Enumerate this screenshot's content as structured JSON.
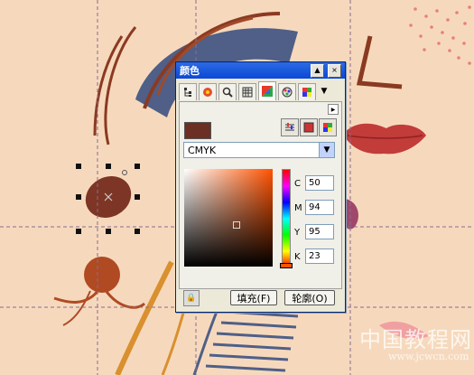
{
  "dialog": {
    "title": "颜色",
    "pin_icon": "▲",
    "close_icon": "×"
  },
  "tabs": [
    {
      "name": "tab-color-eyedropper",
      "icon": "tree-icon"
    },
    {
      "name": "tab-color-harmonies",
      "icon": "flower-icon"
    },
    {
      "name": "tab-color-zoom",
      "icon": "zoom-icon"
    },
    {
      "name": "tab-color-grid",
      "icon": "grid-icon"
    },
    {
      "name": "tab-color-models",
      "icon": "palette-icon"
    },
    {
      "name": "tab-color-mixer",
      "icon": "mixer-icon"
    },
    {
      "name": "tab-color-palettes",
      "icon": "palette-grid-icon"
    }
  ],
  "colors": {
    "accent": "#0b48d6",
    "current_color": "#6b2f23",
    "hue": "#ff5200"
  },
  "model": {
    "selected": "CMYK"
  },
  "picker": {
    "marker_x": 0.59,
    "marker_y": 0.57,
    "hue_level": 0.03
  },
  "cmyk": [
    {
      "label": "C",
      "value": "50"
    },
    {
      "label": "M",
      "value": "94"
    },
    {
      "label": "Y",
      "value": "95"
    },
    {
      "label": "K",
      "value": "23"
    }
  ],
  "buttons": {
    "fill": "填充(F)",
    "outline": "轮廓(O)"
  },
  "watermark": {
    "text": "中国教程网",
    "url": "www.jcwcn.com"
  }
}
